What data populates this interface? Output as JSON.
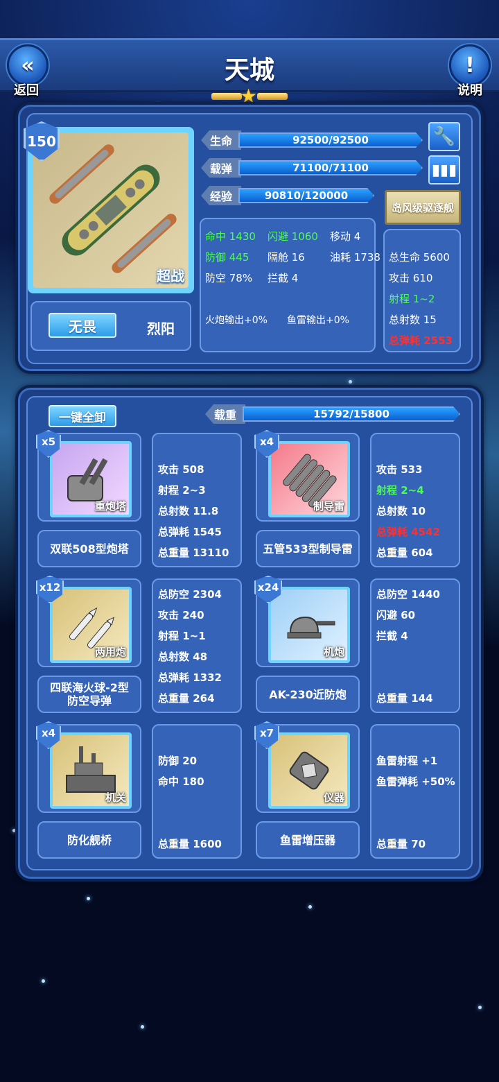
{
  "header": {
    "title": "天城",
    "back_label": "返回",
    "help_label": "说明"
  },
  "ship": {
    "level": "150",
    "class_tag": "超战",
    "tab_active": "无畏",
    "tab_inactive": "烈阳",
    "hp_label": "生命",
    "hp_value": "92500/92500",
    "ammo_label": "载弹",
    "ammo_value": "71100/71100",
    "exp_label": "经验",
    "exp_value": "90810/120000",
    "rival_button": "岛风级驱逐舰",
    "stats": {
      "accuracy": "命中 1430",
      "evasion": "闪避 1060",
      "move": "移动 4",
      "defense": "防御 445",
      "bulkhead": "隔舱 16",
      "fuel": "油耗 1738",
      "aa": "防空 78%",
      "intercept": "拦截 4",
      "gun_output": "火炮输出+0%",
      "torpedo_output": "鱼雷输出+0%"
    },
    "totals": {
      "total_hp": "总生命 5600",
      "attack": "攻击 610",
      "range": "射程 1~2",
      "shots": "总射数 15",
      "ammo_cost": "总弹耗 2553"
    }
  },
  "loadout": {
    "unload_all": "一键全卸",
    "capacity_label": "载重",
    "capacity_value": "15792/15800",
    "items": [
      {
        "qty": "x5",
        "type": "重炮塔",
        "name": "双联508型炮塔",
        "stats": [
          "攻击 508",
          "射程 2~3",
          "总射数 11.8",
          "总弹耗 1545"
        ],
        "weight": "总重量 13110"
      },
      {
        "qty": "x4",
        "type": "制导雷",
        "name": "五管533型制导雷",
        "stats": [
          "攻击 533",
          "射程 2~4",
          "总射数 10",
          "总弹耗 4542"
        ],
        "weight": "总重量 604"
      },
      {
        "qty": "x12",
        "type": "两用炮",
        "name_line1": "四联海火球-2型",
        "name_line2": "防空导弹",
        "stats": [
          "总防空 2304",
          "攻击 240",
          "射程 1~1",
          "总射数 48",
          "总弹耗 1332"
        ],
        "weight": "总重量 264"
      },
      {
        "qty": "x24",
        "type": "机炮",
        "name": "AK-230近防炮",
        "stats": [
          "总防空 1440",
          "闪避 60",
          "拦截 4"
        ],
        "weight": "总重量 144"
      },
      {
        "qty": "x4",
        "type": "机关",
        "name": "防化舰桥",
        "stats": [
          "防御 20",
          "命中 180"
        ],
        "weight": "总重量 1600"
      },
      {
        "qty": "x7",
        "type": "仪器",
        "name": "鱼雷增压器",
        "stats": [
          "鱼雷射程 +1",
          "鱼雷弹耗 +50%"
        ],
        "weight": "总重量 70"
      }
    ]
  }
}
